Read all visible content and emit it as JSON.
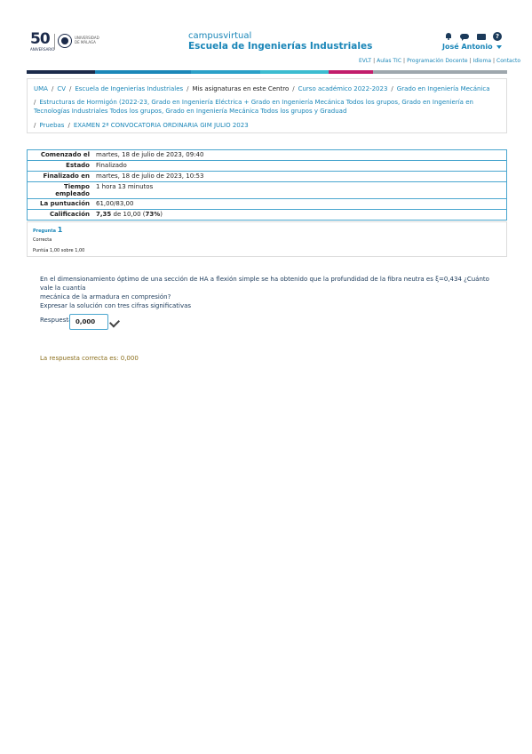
{
  "header": {
    "logo_number": "50",
    "logo_subtitle": "ANIVERSARIO",
    "logo_university": "UNIVERSIDAD DE MÁLAGA",
    "title_line1": "campusvirtual",
    "title_line2": "Escuela de Ingenierías Industriales",
    "user_name": "José Antonio",
    "icons": [
      "bell-icon",
      "chat-icon",
      "mail-icon",
      "help-icon"
    ],
    "help_glyph": "?"
  },
  "top_links": [
    "EVLT",
    "Aulas TIC",
    "Programación Docente",
    "Idioma",
    "Contacto"
  ],
  "top_links_separator": "|",
  "color_bar": [
    "#1b2a4a",
    "#1a86b8",
    "#2aa0c8",
    "#3cbcd0",
    "#c21d6b",
    "#9ea7ad"
  ],
  "breadcrumb": {
    "separator": "/",
    "line1": [
      "UMA",
      "CV",
      "Escuela de Ingenierías Industriales",
      "Mis asignaturas en este Centro",
      "Curso académico 2022-2023",
      "Grado en Ingeniería Mecánica"
    ],
    "line2": "Estructuras de Hormigón (2022-23, Grado en Ingeniería Eléctrica + Grado en Ingeniería Mecánica Todos los grupos, Grado en Ingeniería en Tecnologías Industriales Todos los grupos, Grado en Ingeniería Mecánica Todos los grupos y Graduad",
    "line3": [
      "Pruebas",
      "EXAMEN 2ª CONVOCATORIA ORDINARIA GIM JULIO 2023"
    ]
  },
  "summary": {
    "started_label": "Comenzado el",
    "started_value": "martes, 18 de julio de 2023, 09:40",
    "state_label": "Estado",
    "state_value": "Finalizado",
    "finished_label": "Finalizado en",
    "finished_value": "martes, 18 de julio de 2023, 10:53",
    "time_label": "Tiempo empleado",
    "time_value": "1 hora 13 minutos",
    "score_label": "La puntuación",
    "score_value": "61,00/83,00",
    "grade_label": "Calificación",
    "grade_value": "7,35",
    "grade_mid": "de 10,00 (",
    "grade_pct": "73%",
    "grade_end": ")"
  },
  "question": {
    "label": "Pregunta",
    "number": "1",
    "state": "Correcta",
    "grade": "Puntúa 1,00 sobre 1,00",
    "text_line1": "En el dimensionamiento óptimo de una sección de HA a flexión simple se ha obtenido que la profundidad de la fibra neutra es ξ=0,434 ¿Cuánto vale la cuantía",
    "text_line2": "mecánica de la armadura en compresión?",
    "text_line3": "Expresar la solución con tres cifras significativas",
    "answer_label": "Respuesta:",
    "answer_value": "0,000",
    "correct_answer": "La respuesta correcta es: 0,000"
  }
}
